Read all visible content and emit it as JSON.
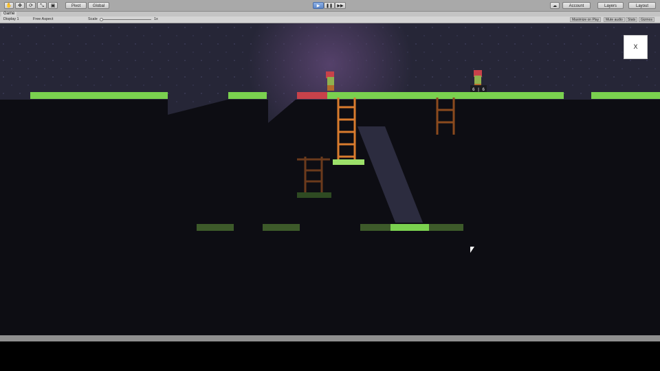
{
  "toolbar": {
    "tools": [
      "✋",
      "✥",
      "⟳",
      "⤡",
      "▣"
    ],
    "pivot_label": "Pivot",
    "global_label": "Global",
    "play_icons": [
      "▶",
      "❚❚",
      "▶▶"
    ],
    "account_label": "Account",
    "layers_label": "Layers",
    "layout_label": "Layout"
  },
  "tab": {
    "label": "Game"
  },
  "gamebar": {
    "display": "Display 1",
    "aspect": "Free Aspect",
    "scale_label": "Scale",
    "scale_value": "1x",
    "maximize": "Maximize on Play",
    "mute": "Mute audio",
    "stats": "Stats",
    "gizmos": "Gizmos"
  },
  "game": {
    "close_label": "X",
    "player_hud": "6 | 6",
    "colors": {
      "grass": "#7ad14f",
      "grass_dim": "#3d5a2a",
      "ladder": "#c96b2c",
      "ladder_dim": "#6b3a1c",
      "red_tile": "#c8424a",
      "dark": "#0d0d13"
    }
  }
}
